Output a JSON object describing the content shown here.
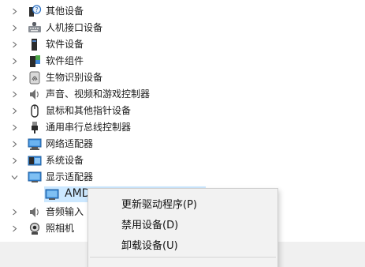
{
  "tree": {
    "items": [
      {
        "label": "其他设备",
        "icon": "unknown-device-icon",
        "expanded": false
      },
      {
        "label": "人机接口设备",
        "icon": "hid-icon",
        "expanded": false
      },
      {
        "label": "软件设备",
        "icon": "software-device-icon",
        "expanded": false
      },
      {
        "label": "软件组件",
        "icon": "software-component-icon",
        "expanded": false
      },
      {
        "label": "生物识别设备",
        "icon": "biometric-icon",
        "expanded": false
      },
      {
        "label": "声音、视频和游戏控制器",
        "icon": "speaker-icon",
        "expanded": false
      },
      {
        "label": "鼠标和其他指针设备",
        "icon": "mouse-icon",
        "expanded": false
      },
      {
        "label": "通用串行总线控制器",
        "icon": "usb-icon",
        "expanded": false
      },
      {
        "label": "网络适配器",
        "icon": "network-adapter-icon",
        "expanded": false
      },
      {
        "label": "系统设备",
        "icon": "system-device-icon",
        "expanded": false
      },
      {
        "label": "显示适配器",
        "icon": "display-adapter-icon",
        "expanded": true
      },
      {
        "label": "音频输入",
        "icon": "audio-input-icon",
        "expanded": false
      },
      {
        "label": "照相机",
        "icon": "camera-icon",
        "expanded": false
      }
    ],
    "selected_child": {
      "label": "AMD",
      "icon": "display-adapter-icon"
    }
  },
  "context_menu": {
    "items": [
      {
        "label": "更新驱动程序(P)"
      },
      {
        "label": "禁用设备(D)"
      },
      {
        "label": "卸载设备(U)"
      }
    ]
  },
  "colors": {
    "selection": "#cce8ff",
    "menu_bg": "#f2f2f2",
    "icon_blue": "#1e6fc4"
  }
}
